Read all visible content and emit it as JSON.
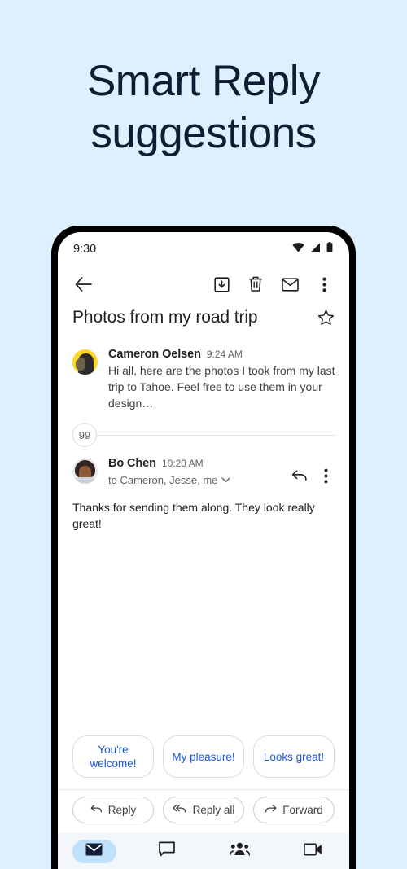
{
  "headline": {
    "line1": "Smart Reply",
    "line2": "suggestions"
  },
  "colors": {
    "page_background": "#ddf0fd",
    "headline_text": "#101c33",
    "chip_text": "#1a56db",
    "nav_active_pill": "#bfe0fb",
    "avatar_cameron": "#fdd726"
  },
  "phone": {
    "status_bar": {
      "time": "9:30",
      "icons": [
        "wifi-icon",
        "cell-signal-icon",
        "battery-icon"
      ]
    },
    "app_bar": {
      "back": "back-arrow-icon",
      "actions": [
        "archive-icon",
        "delete-icon",
        "mark-unread-icon",
        "overflow-menu-icon"
      ]
    },
    "subject": {
      "text": "Photos from my road trip",
      "star": "star-outline-icon"
    },
    "messages": [
      {
        "sender": "Cameron Oelsen",
        "time": "9:24 AM",
        "snippet": "Hi all, here are the photos I took from my last trip to Tahoe. Feel free to use them in your design…"
      },
      {
        "sender": "Bo Chen",
        "time": "10:20 AM",
        "recipients": "to Cameron, Jesse, me",
        "body": "Thanks for sending them along. They look really great!"
      }
    ],
    "collapsed_count": "99",
    "smart_replies": [
      "You're welcome!",
      "My pleasure!",
      "Looks great!"
    ],
    "reply_actions": [
      {
        "label": "Reply",
        "icon": "reply-icon"
      },
      {
        "label": "Reply all",
        "icon": "reply-all-icon"
      },
      {
        "label": "Forward",
        "icon": "forward-icon"
      }
    ],
    "bottom_nav": [
      {
        "icon": "mail-icon",
        "active": true
      },
      {
        "icon": "chat-icon",
        "active": false
      },
      {
        "icon": "spaces-icon",
        "active": false
      },
      {
        "icon": "meet-icon",
        "active": false
      }
    ]
  }
}
